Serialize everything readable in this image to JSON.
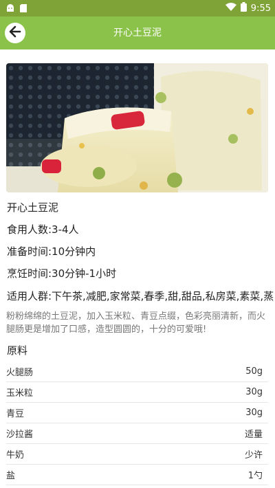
{
  "status_bar": {
    "time": "9:55"
  },
  "app_bar": {
    "title": "开心土豆泥"
  },
  "recipe": {
    "name": "开心土豆泥",
    "servings": "食用人数:3-4人",
    "prep_time": "准备时间:10分钟内",
    "cook_time": "烹饪时间:30分钟-1小时",
    "suitable_for": "适用人群:下午茶,减肥,家常菜,春季,甜,甜品,私房菜,素菜,蒸",
    "description": "粉粉绵绵的土豆泥，加入玉米粒、青豆点缀，色彩亮丽清新，而火腿肠更是增加了口感，造型圆圆的，十分的可爱哦!"
  },
  "ingredients_section": {
    "title": "原料",
    "items": [
      {
        "name": "火腿肠",
        "amount": "50g"
      },
      {
        "name": "玉米粒",
        "amount": "30g"
      },
      {
        "name": "青豆",
        "amount": "30g"
      },
      {
        "name": "沙拉酱",
        "amount": "适量"
      },
      {
        "name": "牛奶",
        "amount": "少许"
      },
      {
        "name": "盐",
        "amount": "1勺"
      }
    ]
  },
  "colors": {
    "status_bar": "#7fa336",
    "app_bar": "#8bc34a"
  }
}
